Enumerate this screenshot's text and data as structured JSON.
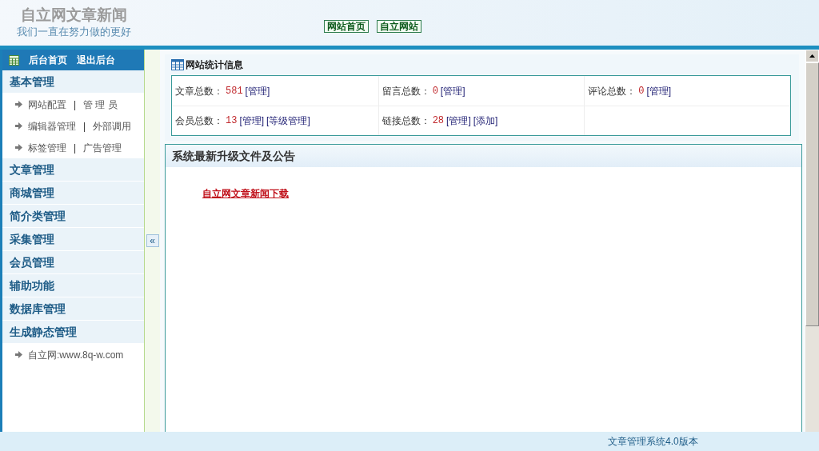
{
  "header": {
    "logo_title": "自立网文章新闻",
    "slogan": "我们一直在努力做的更好",
    "nav_buttons": [
      "网站首页",
      "自立网站"
    ]
  },
  "sidebar": {
    "top_links": [
      "后台首页",
      "退出后台"
    ],
    "groups": [
      {
        "title": "基本管理",
        "items": [
          {
            "parts": [
              {
                "kind": "link",
                "text": "网站配置"
              },
              {
                "kind": "separator",
                "text": "|"
              },
              {
                "kind": "link",
                "text": "管 理 员"
              }
            ]
          },
          {
            "parts": [
              {
                "kind": "link",
                "text": "编辑器管理"
              },
              {
                "kind": "separator",
                "text": "|"
              },
              {
                "kind": "link",
                "text": "外部调用"
              }
            ]
          },
          {
            "parts": [
              {
                "kind": "link",
                "text": "标签管理"
              },
              {
                "kind": "separator",
                "text": "|"
              },
              {
                "kind": "link",
                "text": "广告管理"
              }
            ]
          }
        ]
      },
      {
        "title": "文章管理"
      },
      {
        "title": "商城管理"
      },
      {
        "title": "简介类管理"
      },
      {
        "title": "采集管理"
      },
      {
        "title": "会员管理"
      },
      {
        "title": "辅助功能"
      },
      {
        "title": "数据库管理"
      },
      {
        "title": "生成静态管理",
        "items": [
          {
            "parts": [
              {
                "kind": "link",
                "text": "自立网:www.8q-w.com"
              }
            ]
          }
        ]
      }
    ],
    "collapse_button": "«"
  },
  "stats": {
    "title": "网站统计信息",
    "cells": [
      {
        "label": "文章总数：",
        "value": "581",
        "links": [
          "[管理]"
        ]
      },
      {
        "label": "留言总数：",
        "value": "0",
        "links": [
          "[管理]"
        ]
      },
      {
        "label": "评论总数：",
        "value": "0",
        "links": [
          "[管理]"
        ]
      },
      {
        "label": "会员总数：",
        "value": "13",
        "links": [
          "[管理]",
          "[等级管理]"
        ]
      },
      {
        "label": "链接总数：",
        "value": "28",
        "links": [
          "[管理]",
          "[添加]"
        ]
      }
    ]
  },
  "announcements": {
    "title": "系统最新升级文件及公告",
    "link": "自立网文章新闻下载"
  },
  "footer": {
    "text": "文章管理系统4.0版本"
  }
}
